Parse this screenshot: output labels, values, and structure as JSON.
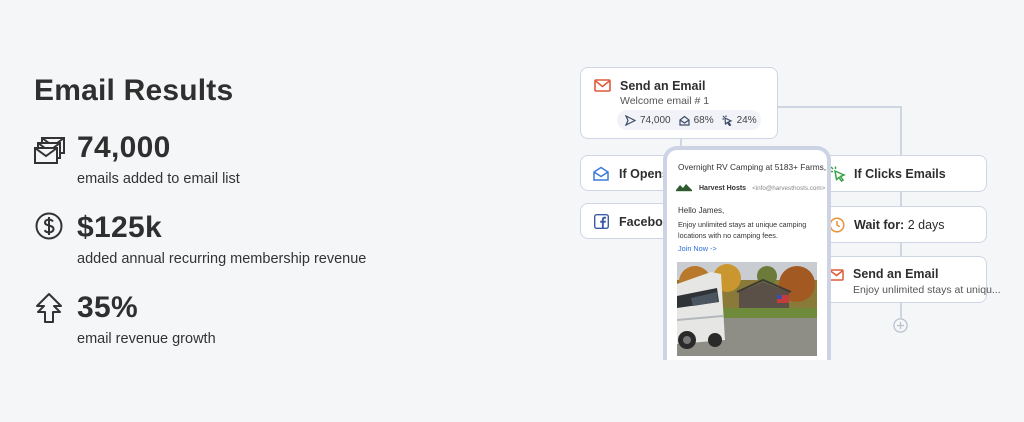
{
  "title": "Email Results",
  "stats": [
    {
      "icon": "envelopes-icon",
      "value": "74,000",
      "desc": "emails added to email list"
    },
    {
      "icon": "dollar-circle-icon",
      "value": "$125k",
      "desc": "added annual recurring membership revenue"
    },
    {
      "icon": "growth-arrow-icon",
      "value": "35%",
      "desc": "email revenue growth"
    }
  ],
  "flow": {
    "send_top": {
      "title": "Send an Email",
      "sub": "Welcome email # 1",
      "sent": "74,000",
      "opened": "68%",
      "clicked": "24%"
    },
    "if_opens": "If Opens",
    "facebook": "Faceboo",
    "if_clicks": "If Clicks Emails",
    "wait_label": "Wait for:",
    "wait_value": "2 days",
    "send_bottom": {
      "title": "Send an Email",
      "sub": "Enjoy unlimited stays at uniqu..."
    },
    "colors": {
      "email_red": "#e05a3a",
      "open_blue": "#3b7bd8",
      "click_green": "#3aa34a",
      "wait_orange": "#e8933a",
      "facebook_blue": "#3b5ba5"
    }
  },
  "phone": {
    "subject": "Overnight RV Camping at 5183+ Farms,...",
    "sender_name": "Harvest Hosts",
    "sender_email": "<info@harvesthosts.com>",
    "greeting": "Hello James,",
    "body": "Enjoy unlimited stays at unique camping locations with no camping fees.",
    "cta": "Join Now ->"
  }
}
